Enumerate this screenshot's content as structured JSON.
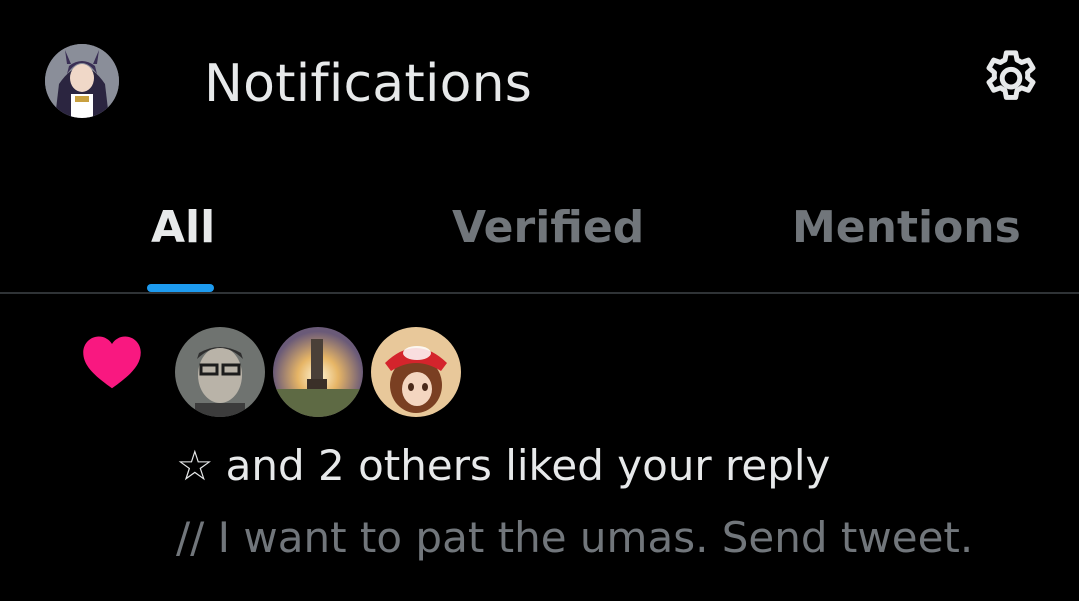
{
  "header": {
    "title": "Notifications",
    "settings_icon": "gear-icon",
    "avatar_icon": "user-avatar"
  },
  "tabs": [
    {
      "label": "All",
      "active": true
    },
    {
      "label": "Verified",
      "active": false
    },
    {
      "label": "Mentions",
      "active": false
    }
  ],
  "notification": {
    "type_icon": "heart-icon",
    "actor_glyph": "☆",
    "text": "and 2 others liked your reply",
    "preview": "// I want to pat the umas. Send tweet."
  },
  "colors": {
    "background": "#000000",
    "primary_text": "#e7e9ea",
    "secondary_text": "#71767b",
    "accent": "#1d9bf0",
    "like": "#f91880",
    "divider": "#2f3336"
  }
}
